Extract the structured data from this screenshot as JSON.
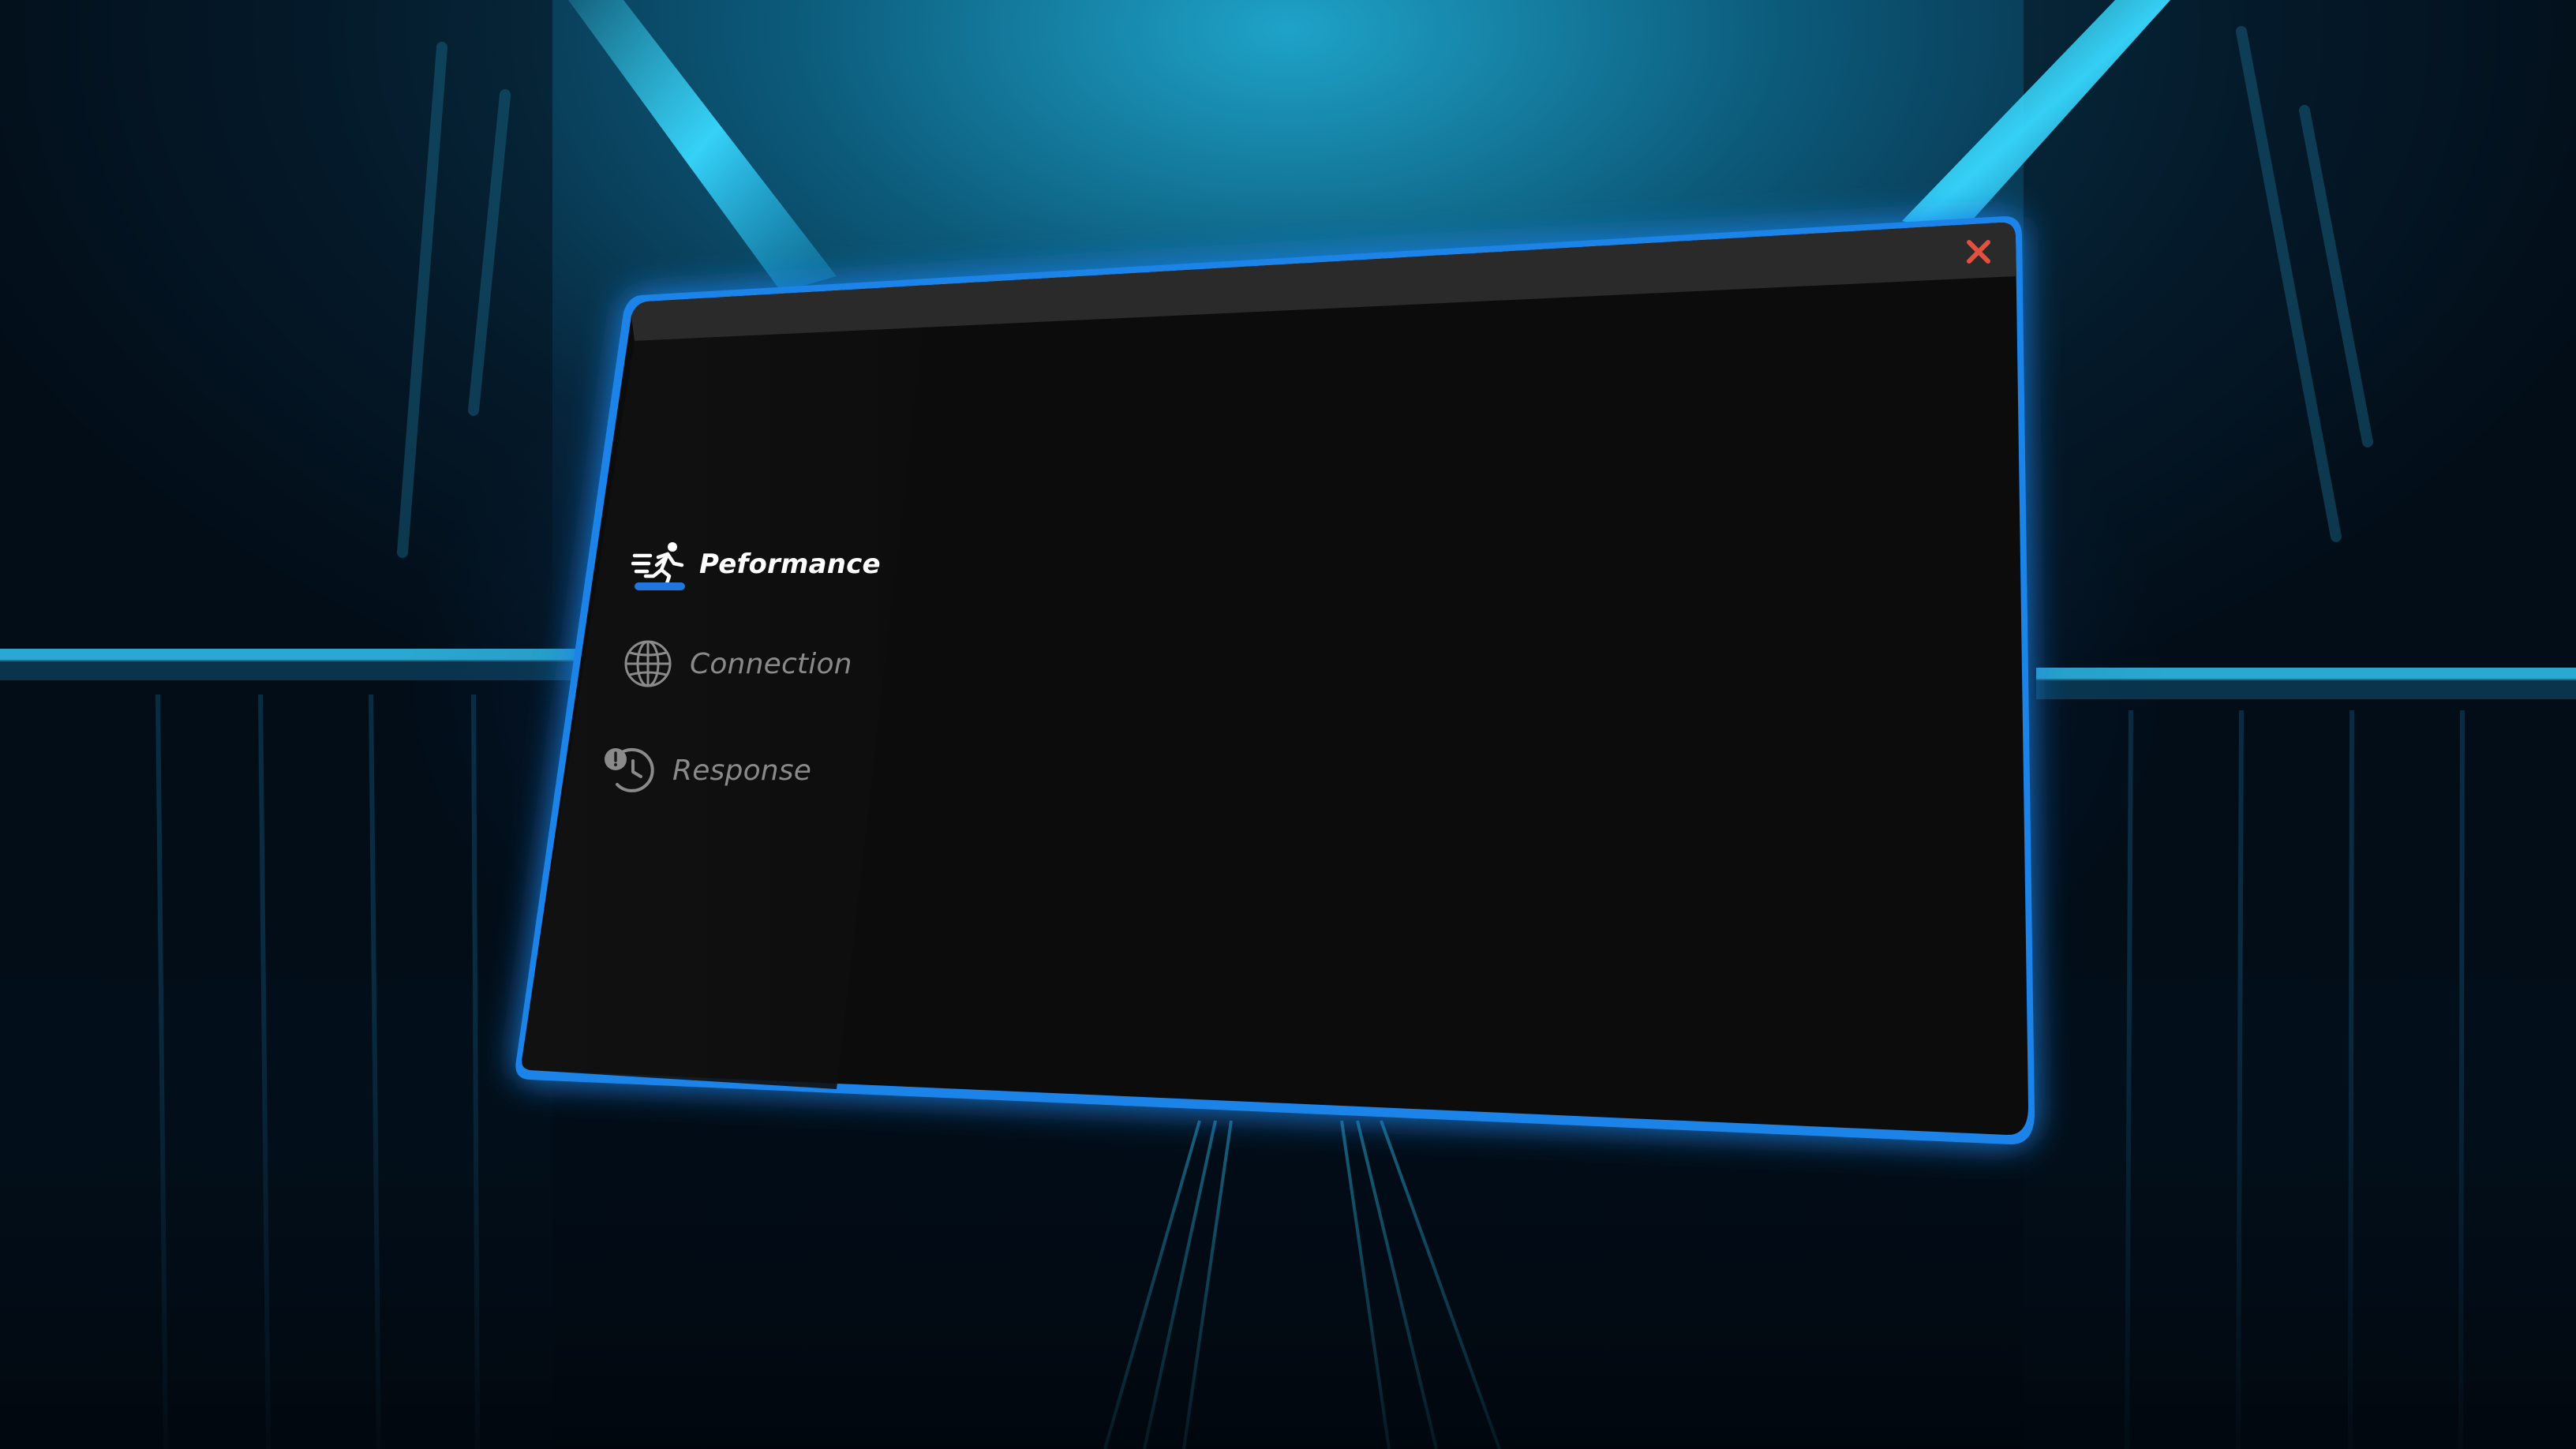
{
  "window": {
    "close_icon": "close-icon",
    "close_color": "#e2513f",
    "accent_color": "#1f76dd"
  },
  "sidebar": {
    "items": [
      {
        "label": "Peformance",
        "icon": "running-person-icon",
        "active": true
      },
      {
        "label": "Connection",
        "icon": "globe-icon",
        "active": false
      },
      {
        "label": "Response",
        "icon": "clock-history-icon",
        "active": false
      }
    ]
  }
}
